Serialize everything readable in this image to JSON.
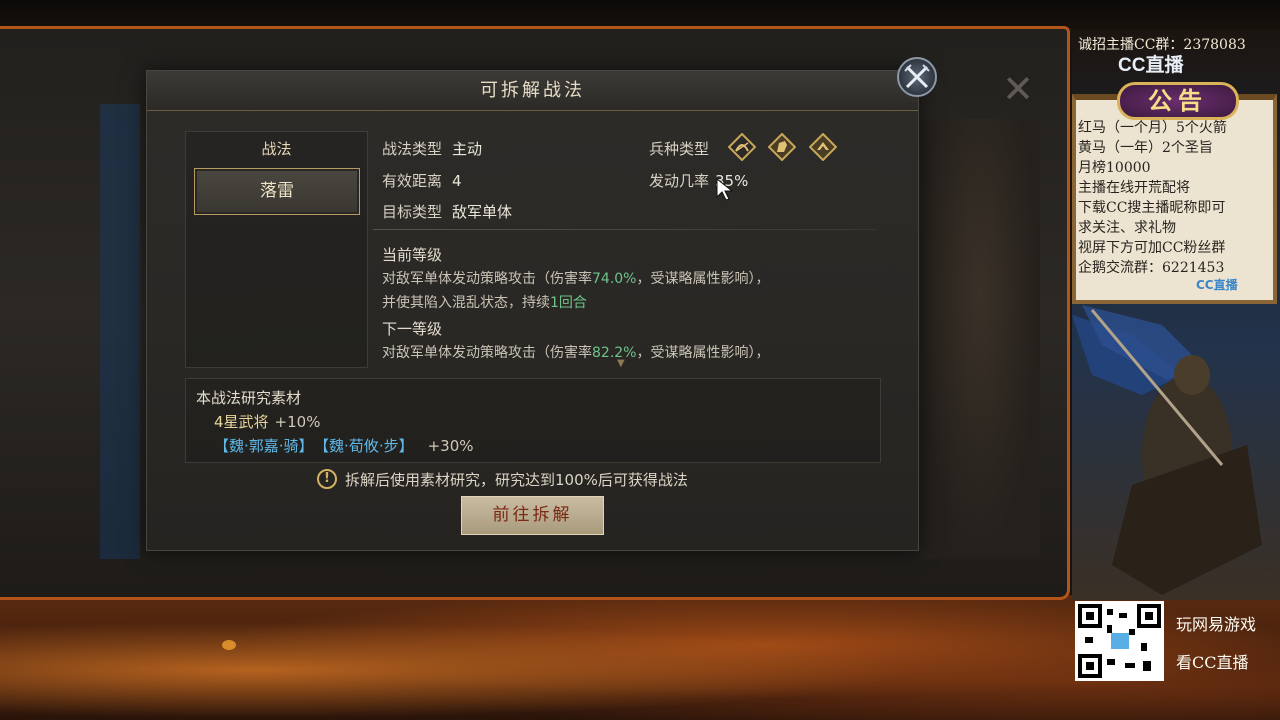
{
  "dialog": {
    "title": "可拆解战法",
    "left_panel": {
      "header": "战法",
      "selected_tactic": "落雷"
    },
    "info": {
      "tactic_type_label": "战法类型",
      "tactic_type_value": "主动",
      "range_label": "有效距离",
      "range_value": "4",
      "target_label": "目标类型",
      "target_value": "敌军单体",
      "unit_type_label": "兵种类型",
      "unit_type_icons": [
        "archer-icon",
        "cavalry-icon",
        "infantry-icon"
      ],
      "trigger_rate_label": "发动几率",
      "trigger_rate_value": "35%"
    },
    "description": {
      "current_level_label": "当前等级",
      "current_line1_pre": "对敌军单体发动策略攻击（伤害率",
      "current_damage": "74.0%",
      "current_line1_post": "，受谋略属性影响），",
      "current_line2_pre": "并使其陷入混乱状态，持续",
      "current_duration": "1回合",
      "next_level_label": "下一等级",
      "next_line1_pre": "对敌军单体发动策略攻击（伤害率",
      "next_damage": "82.2%",
      "next_line1_post": "，受谋略属性影响），"
    },
    "materials": {
      "title": "本战法研究素材",
      "line1_label": "4星武将",
      "line1_bonus": "+10%",
      "generals": [
        "【魏·郭嘉·骑】",
        "【魏·荀攸·步】"
      ],
      "line2_bonus": "+30%"
    },
    "warning_text": "拆解后使用素材研究，研究达到100%后可获得战法",
    "go_button": "前往拆解",
    "colors": {
      "highlight_green": "#6fc28a",
      "general_blue": "#5fb8e8",
      "gold_text": "#e6d59c",
      "button_text": "#7a2a14"
    }
  },
  "stream": {
    "recruit_text": "诚招主播CC群：2378083",
    "logo": "CC直播",
    "notice_title": "公告",
    "notice_lines": [
      "红马（一个月）5个火箭",
      "黄马（一年）2个圣旨",
      "月榜10000",
      "主播在线开荒配将",
      "下载CC搜主播昵称即可",
      "求关注、求礼物",
      "视屏下方可加CC粉丝群",
      "企鹅交流群：6221453"
    ],
    "notice_logo": "CC直播",
    "qr_side_line1": "玩网易游戏",
    "qr_side_line2": "看CC直播"
  }
}
